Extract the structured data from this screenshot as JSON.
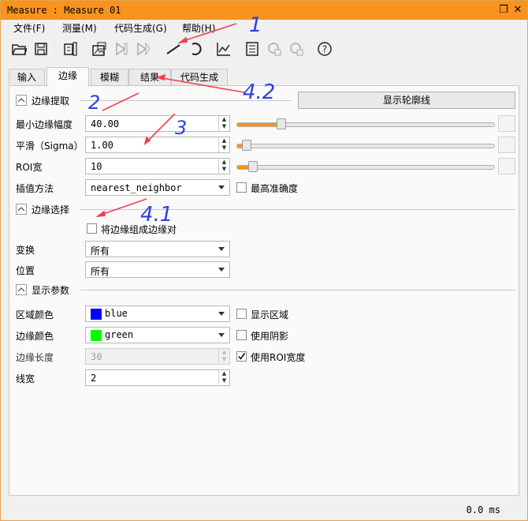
{
  "window": {
    "title": "Measure : Measure 01"
  },
  "menu": [
    "文件(F)",
    "测量(M)",
    "代码生成(G)",
    "帮助(H)"
  ],
  "toolbar_icons": [
    "open-icon",
    "save-icon",
    "camera-icon",
    "image-icon",
    "play-icon",
    "play-next-icon",
    "line-tool-icon",
    "arc-tool-icon",
    "graph-icon",
    "list-icon",
    "add-item-icon",
    "add-item-2-icon",
    "help-icon"
  ],
  "tabs": [
    "输入",
    "边缘",
    "模糊",
    "结果",
    "代码生成"
  ],
  "edge_extract": {
    "header": "边缘提取",
    "show_contour_button": "显示轮廓线",
    "min_amplitude_label": "最小边缘幅度",
    "min_amplitude_value": "40.00",
    "smooth_label": "平滑（Sigma）",
    "smooth_value": "1.00",
    "roi_width_label": "ROI宽",
    "roi_width_value": "10",
    "interp_label": "插值方法",
    "interp_value": "nearest_neighbor",
    "max_precision_label": "最高准确度"
  },
  "edge_select": {
    "header": "边缘选择",
    "pair_label": "将边缘组成边缘对",
    "transition_label": "变换",
    "transition_value": "所有",
    "position_label": "位置",
    "position_value": "所有"
  },
  "display": {
    "header": "显示参数",
    "region_color_label": "区域颜色",
    "region_color_value": "blue",
    "region_color_hex": "#0000ff",
    "show_region_label": "显示区域",
    "edge_color_label": "边缘颜色",
    "edge_color_value": "green",
    "edge_color_hex": "#00ff00",
    "use_shadow_label": "使用阴影",
    "edge_length_label": "边缘长度",
    "edge_length_value": "30",
    "use_roi_width_label": "使用ROI宽度",
    "line_width_label": "线宽",
    "line_width_value": "2"
  },
  "status": {
    "time": "0.0 ms"
  },
  "annotations": [
    "1",
    "4.2",
    "2",
    "3",
    "4.1"
  ]
}
